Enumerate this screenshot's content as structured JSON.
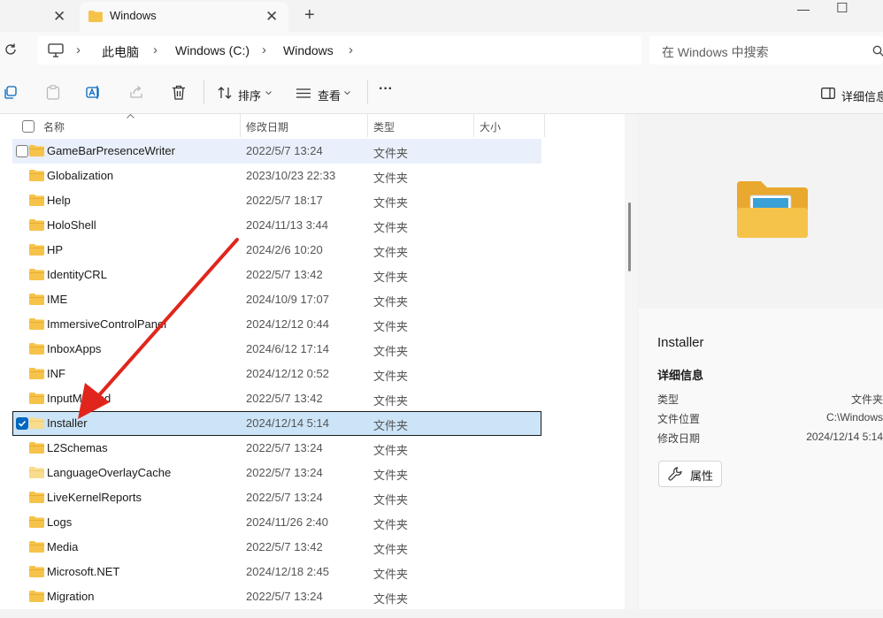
{
  "tab": {
    "title": "Windows",
    "close": "✕",
    "new": "+"
  },
  "window_controls": {
    "minimize": "—",
    "maximize": "☐"
  },
  "address": {
    "crumbs": [
      "此电脑",
      "Windows (C:)",
      "Windows"
    ],
    "chevron": "›"
  },
  "search": {
    "placeholder": "在 Windows 中搜索"
  },
  "toolbar": {
    "sort_label": "排序",
    "view_label": "查看",
    "more": "···",
    "details_label": "详细信息"
  },
  "columns": {
    "name": "名称",
    "date": "修改日期",
    "type": "类型",
    "size": "大小"
  },
  "rows": [
    {
      "name": "GameBarPresenceWriter",
      "date": "2022/5/7 13:24",
      "type": "文件夹"
    },
    {
      "name": "Globalization",
      "date": "2023/10/23 22:33",
      "type": "文件夹"
    },
    {
      "name": "Help",
      "date": "2022/5/7 18:17",
      "type": "文件夹"
    },
    {
      "name": "HoloShell",
      "date": "2024/11/13 3:44",
      "type": "文件夹"
    },
    {
      "name": "HP",
      "date": "2024/2/6 10:20",
      "type": "文件夹"
    },
    {
      "name": "IdentityCRL",
      "date": "2022/5/7 13:42",
      "type": "文件夹"
    },
    {
      "name": "IME",
      "date": "2024/10/9 17:07",
      "type": "文件夹"
    },
    {
      "name": "ImmersiveControlPanel",
      "date": "2024/12/12 0:44",
      "type": "文件夹"
    },
    {
      "name": "InboxApps",
      "date": "2024/6/12 17:14",
      "type": "文件夹"
    },
    {
      "name": "INF",
      "date": "2024/12/12 0:52",
      "type": "文件夹"
    },
    {
      "name": "InputMethod",
      "date": "2022/5/7 13:42",
      "type": "文件夹"
    },
    {
      "name": "Installer",
      "date": "2024/12/14 5:14",
      "type": "文件夹"
    },
    {
      "name": "L2Schemas",
      "date": "2022/5/7 13:24",
      "type": "文件夹"
    },
    {
      "name": "LanguageOverlayCache",
      "date": "2022/5/7 13:24",
      "type": "文件夹"
    },
    {
      "name": "LiveKernelReports",
      "date": "2022/5/7 13:24",
      "type": "文件夹"
    },
    {
      "name": "Logs",
      "date": "2024/11/26 2:40",
      "type": "文件夹"
    },
    {
      "name": "Media",
      "date": "2022/5/7 13:42",
      "type": "文件夹"
    },
    {
      "name": "Microsoft.NET",
      "date": "2024/12/18 2:45",
      "type": "文件夹"
    },
    {
      "name": "Migration",
      "date": "2022/5/7 13:24",
      "type": "文件夹"
    }
  ],
  "details": {
    "title": "Installer",
    "section": "详细信息",
    "type_label": "类型",
    "type_value": "文件夹",
    "location_label": "文件位置",
    "location_value": "C:\\Windows",
    "modified_label": "修改日期",
    "modified_value": "2024/12/14 5:14",
    "properties_label": "属性"
  },
  "colors": {
    "accent": "#0067c0",
    "selection": "#cce4f7",
    "folder": "#f6c34a",
    "arrow": "#e0261c"
  }
}
